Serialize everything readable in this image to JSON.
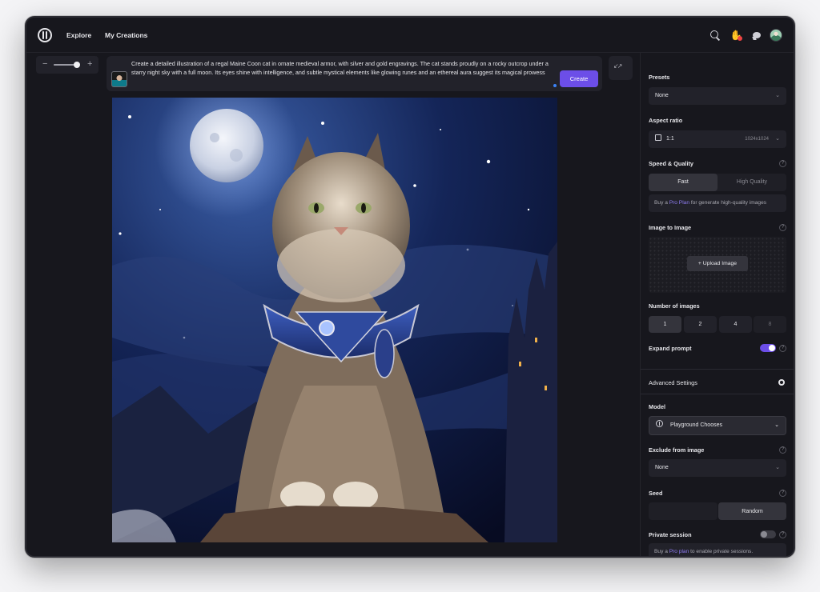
{
  "nav": {
    "explore": "Explore",
    "my_creations": "My Creations"
  },
  "zoom": {
    "minus": "−",
    "plus": "+",
    "level": 0.9
  },
  "prompt": {
    "text": "Create a detailed illustration of a regal Maine Coon cat in ornate medieval armor, with silver and gold engravings. The cat stands proudly on a rocky outcrop under a starry night sky with a full moon. Its eyes shine with intelligence, and subtle mystical elements like glowing runes and an ethereal aura suggest its magical prowess",
    "create_label": "Create"
  },
  "panel": {
    "presets": {
      "label": "Presets",
      "value": "None"
    },
    "aspect_ratio": {
      "label": "Aspect ratio",
      "value": "1:1",
      "size": "1024x1024"
    },
    "speed_quality": {
      "label": "Speed & Quality",
      "options": [
        "Fast",
        "High Quality"
      ],
      "selected": "Fast",
      "notice_prefix": "Buy a ",
      "notice_link": "Pro Plan",
      "notice_suffix": " for generate high-quality images"
    },
    "image_to_image": {
      "label": "Image to Image",
      "upload_label": "+  Upload Image"
    },
    "number_of_images": {
      "label": "Number of images",
      "options": [
        "1",
        "2",
        "4",
        "8"
      ],
      "selected": "1"
    },
    "expand_prompt": {
      "label": "Expand prompt",
      "enabled": true
    },
    "advanced_settings": {
      "label": "Advanced Settings"
    },
    "model": {
      "label": "Model",
      "value": "Playground Chooses"
    },
    "exclude": {
      "label": "Exclude from image",
      "value": "None"
    },
    "seed": {
      "label": "Seed",
      "random_label": "Random"
    },
    "private_session": {
      "label": "Private session",
      "enabled": false,
      "notice_prefix": "Buy a ",
      "notice_link": "Pro plan",
      "notice_suffix": " to enable private sessions."
    },
    "help_glyph": "?",
    "chevron_glyph": "⌄"
  },
  "colors": {
    "accent": "#6c4ee8",
    "background": "#17171d",
    "surface": "#22222a",
    "link": "#8f7cf2"
  },
  "icons": [
    "logo-icon",
    "search-icon",
    "hand-icon",
    "chat-icon",
    "avatar",
    "expand-icon",
    "square-icon",
    "gear-icon",
    "model-icon",
    "chevron-down-icon",
    "help-icon"
  ]
}
